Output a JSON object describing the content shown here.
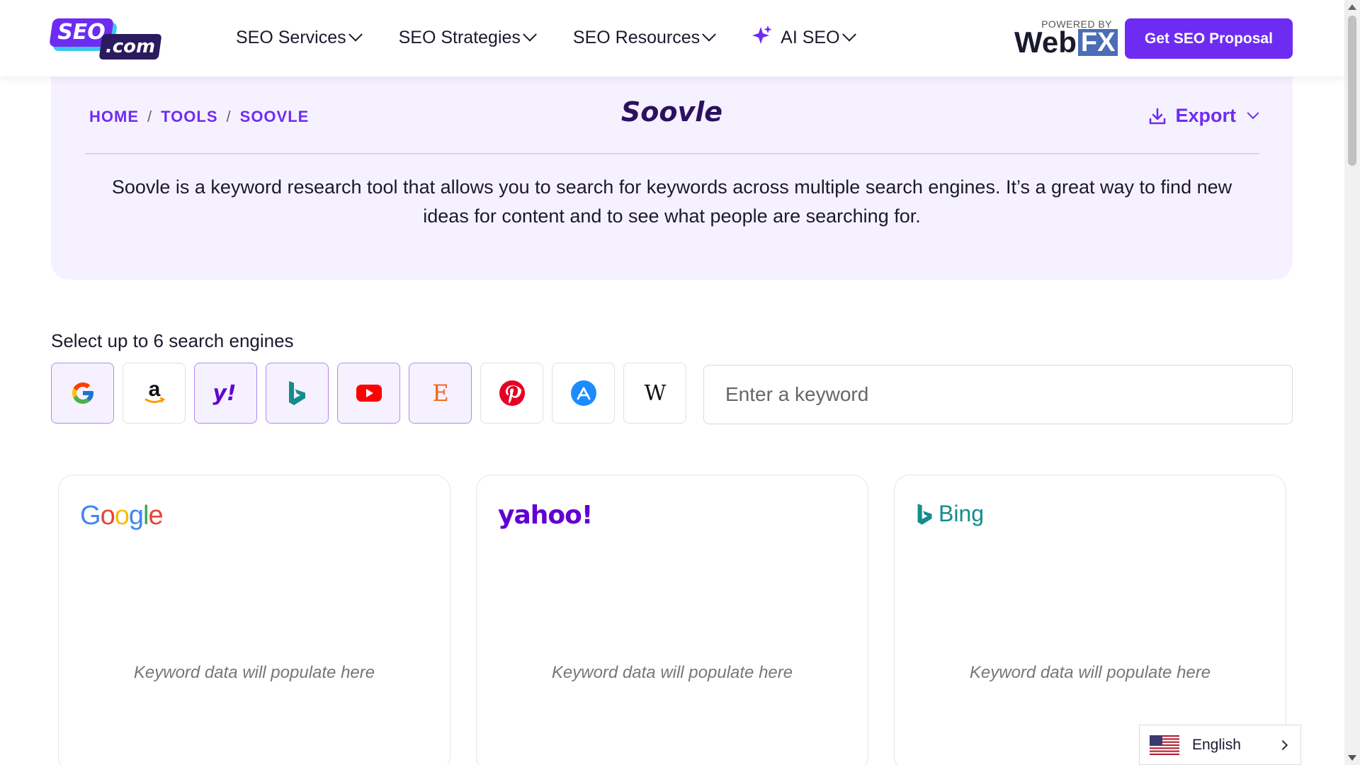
{
  "header": {
    "logo_seo": "SEO",
    "logo_com": ".com",
    "nav": [
      {
        "label": "SEO Services"
      },
      {
        "label": "SEO Strategies"
      },
      {
        "label": "SEO Resources"
      },
      {
        "label": "AI SEO",
        "icon": "sparkle-icon"
      }
    ],
    "powered_by": "POWERED BY",
    "partner_web": "Web",
    "partner_fx": "FX",
    "cta_label": "Get SEO Proposal"
  },
  "hero": {
    "breadcrumb": [
      "HOME",
      "TOOLS",
      "SOOVLE"
    ],
    "breadcrumb_sep": "/",
    "title": "Soovle",
    "export_label": "Export",
    "description": "Soovle is a keyword research tool that allows you to search for keywords across multiple search engines. It’s a great way to find new ideas for content and to see what people are searching for."
  },
  "search": {
    "label": "Select up to 6 search engines",
    "placeholder": "Enter a keyword",
    "value": "",
    "engines": [
      {
        "name": "google",
        "selected": true
      },
      {
        "name": "amazon",
        "selected": false
      },
      {
        "name": "yahoo",
        "selected": true
      },
      {
        "name": "bing",
        "selected": true
      },
      {
        "name": "youtube",
        "selected": true
      },
      {
        "name": "etsy",
        "selected": true
      },
      {
        "name": "pinterest",
        "selected": false
      },
      {
        "name": "app-store",
        "selected": false
      },
      {
        "name": "wikipedia",
        "selected": false
      }
    ]
  },
  "results": {
    "placeholder": "Keyword data will populate here",
    "bing_label": "Bing",
    "yahoo_label": "yahoo!"
  },
  "language": {
    "label": "English"
  },
  "colors": {
    "accent": "#6e2cf2",
    "hero_bg": "#f6f1ff",
    "title": "#2a1260"
  }
}
